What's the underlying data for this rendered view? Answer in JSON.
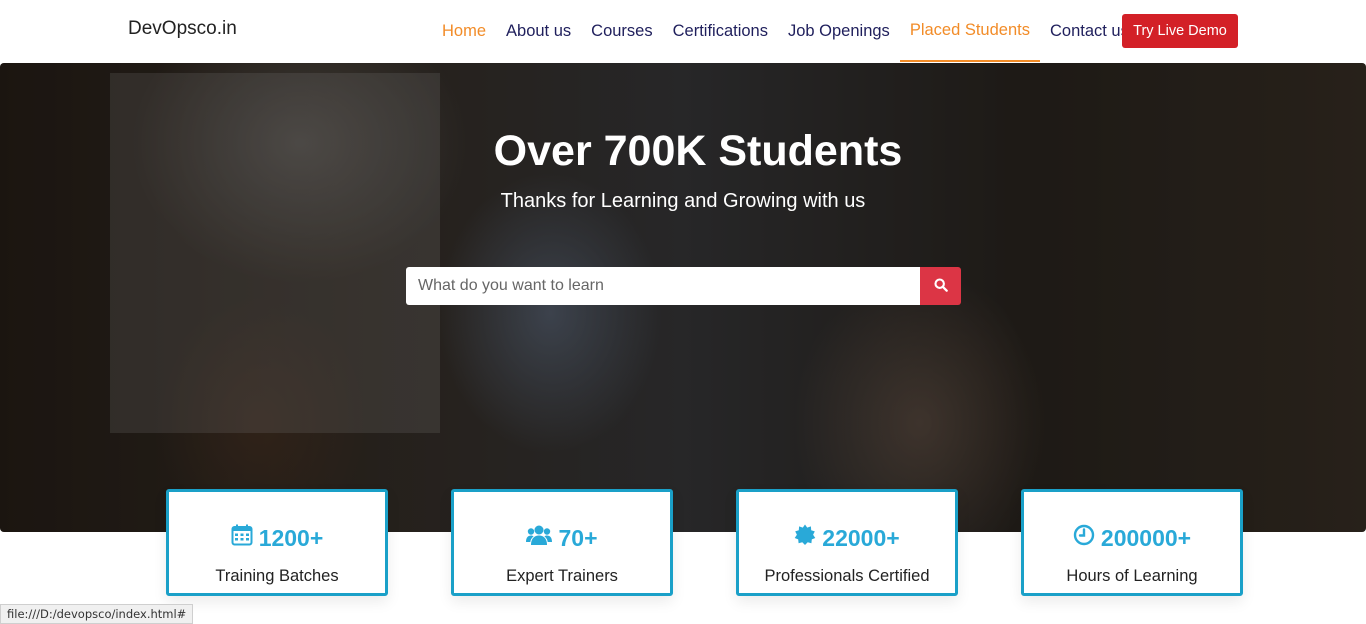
{
  "brand": "DevOpsco.in",
  "nav": {
    "items": [
      {
        "label": "Home"
      },
      {
        "label": "About us"
      },
      {
        "label": "Courses"
      },
      {
        "label": "Certifications"
      },
      {
        "label": "Job Openings"
      },
      {
        "label": "Placed Students"
      },
      {
        "label": "Contact us"
      }
    ],
    "demo_button": "Try Live Demo"
  },
  "hero": {
    "title": "Over 700K Students",
    "subtitle": "Thanks for Learning and Growing with us",
    "search_placeholder": "What do you want to learn"
  },
  "stats": [
    {
      "icon": "calendar-icon",
      "value": "1200+",
      "label": "Training Batches"
    },
    {
      "icon": "users-icon",
      "value": "70+",
      "label": "Expert Trainers"
    },
    {
      "icon": "certificate-icon",
      "value": "22000+",
      "label": "Professionals Certified"
    },
    {
      "icon": "clock-icon",
      "value": "200000+",
      "label": "Hours of Learning"
    }
  ],
  "status_bar": "file:///D:/devopsco/index.html#",
  "colors": {
    "accent_orange": "#f28c28",
    "nav_text": "#1f1f5c",
    "demo_red": "#d32027",
    "search_red": "#dc3545",
    "stat_blue": "#29a9d8",
    "card_border": "#1aa0c8"
  }
}
